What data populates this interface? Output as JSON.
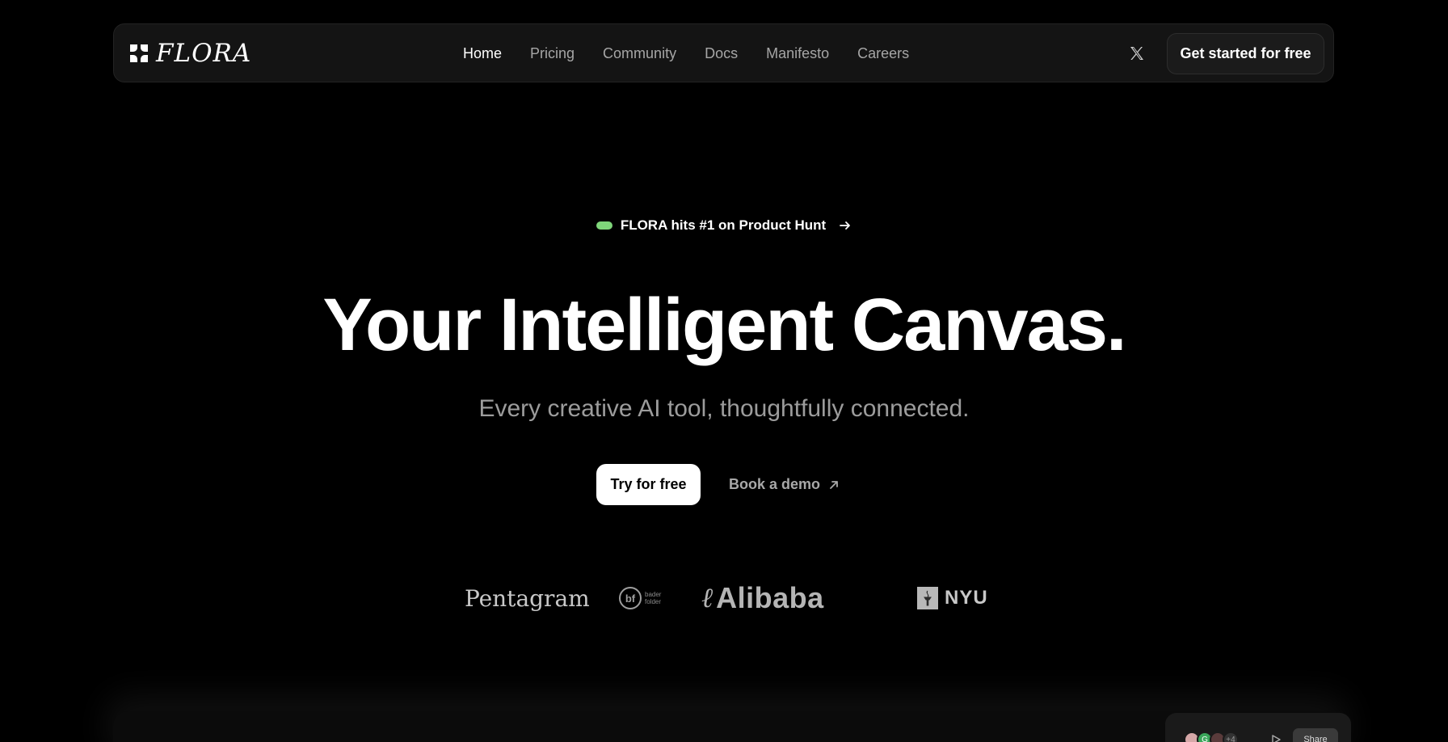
{
  "nav": {
    "brand": "FLORA",
    "links": [
      {
        "label": "Home",
        "active": true
      },
      {
        "label": "Pricing",
        "active": false
      },
      {
        "label": "Community",
        "active": false
      },
      {
        "label": "Docs",
        "active": false
      },
      {
        "label": "Manifesto",
        "active": false
      },
      {
        "label": "Careers",
        "active": false
      }
    ],
    "social_icon": "x-icon",
    "cta_label": "Get started for free"
  },
  "announcement": {
    "text": "FLORA hits #1 on Product Hunt",
    "pill_color": "#7fd67a",
    "icon": "arrow-right-icon"
  },
  "hero": {
    "title": "Your Intelligent Canvas.",
    "subtitle": "Every creative AI tool, thoughtfully connected.",
    "primary_cta": "Try for free",
    "secondary_cta": "Book a demo",
    "secondary_icon": "arrow-up-right-icon"
  },
  "logos": {
    "pentagram": "Pentagram",
    "bf_mark": "bf",
    "bf_text_line1": "bader",
    "bf_text_line2": "folder",
    "alibaba_mark": "ℓ",
    "alibaba": "Alibaba",
    "nyu": "NYU"
  },
  "preview": {
    "avatar_2": "G",
    "avatar_4": "+4",
    "share_label": "Share"
  },
  "colors": {
    "background": "#000000",
    "nav_bg": "#141414",
    "primary_button_bg": "#ffffff",
    "muted_text": "#a6a6a6"
  }
}
